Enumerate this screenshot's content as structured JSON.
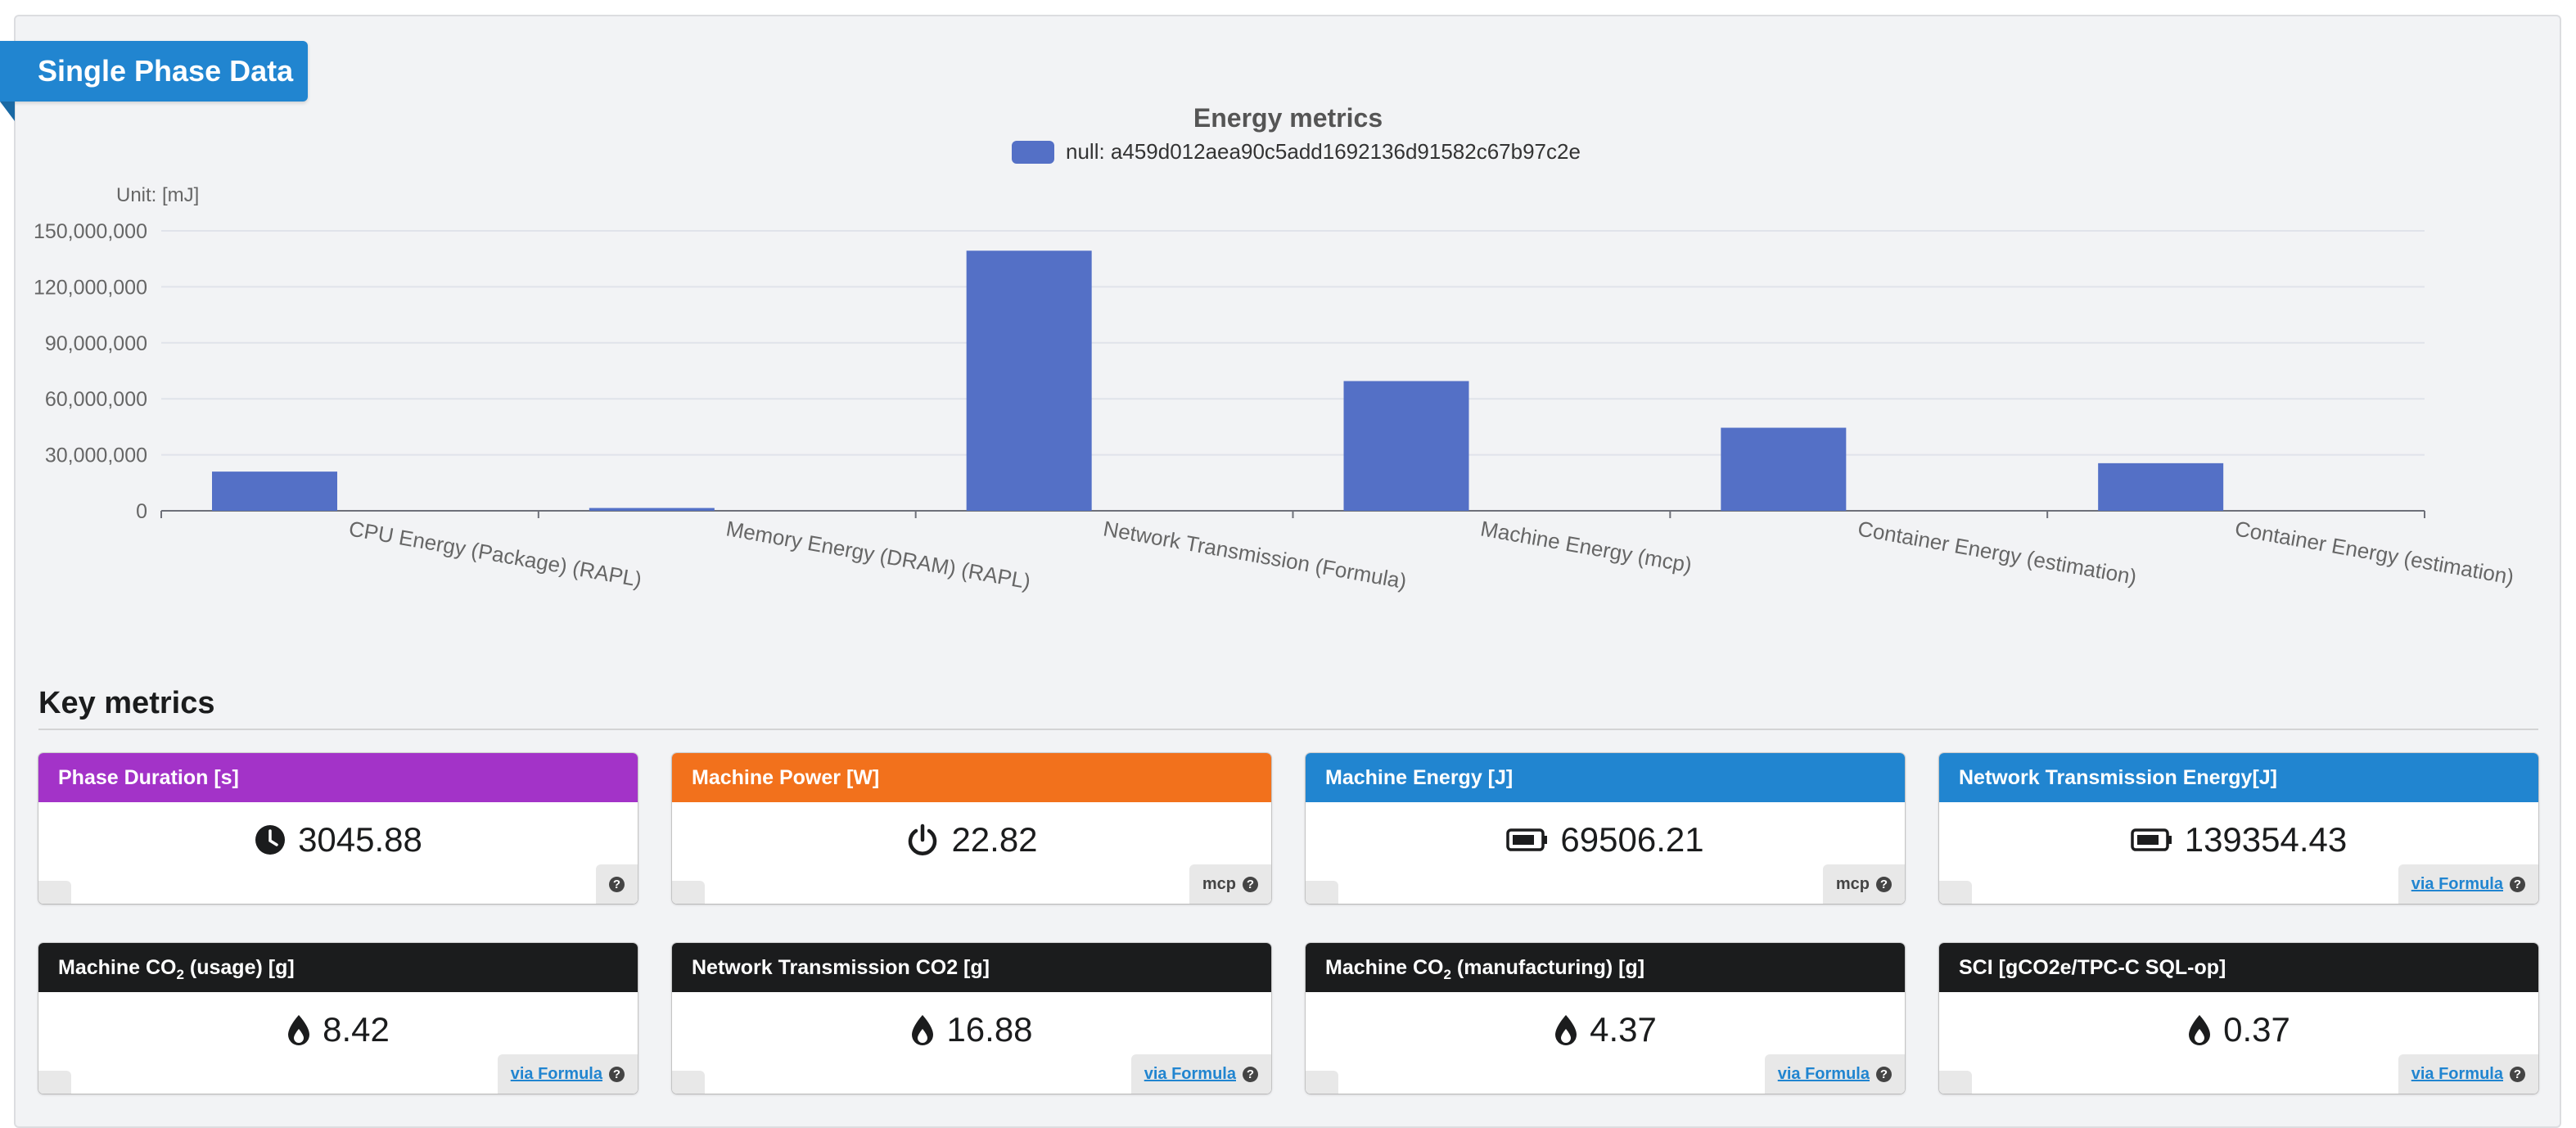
{
  "ribbon": {
    "title": "Single Phase Data"
  },
  "chart_data": {
    "type": "bar",
    "title": "Energy metrics",
    "legend": "null: a459d012aea90c5add1692136d91582c67b97c2e",
    "unit_label": "Unit: [mJ]",
    "categories": [
      "CPU Energy (Package) (RAPL)",
      "Memory Energy (DRAM) (RAPL)",
      "Network Transmission (Formula)",
      "Machine Energy (mcp)",
      "Container Energy (estimation)",
      "Container Energy (estimation)"
    ],
    "values": [
      21000000,
      1500000,
      139354430,
      69506210,
      44500000,
      25500000
    ],
    "ylim": [
      0,
      150000000
    ],
    "yticks": [
      0,
      30000000,
      60000000,
      90000000,
      120000000,
      150000000
    ],
    "ytick_labels": [
      "0",
      "30,000,000",
      "60,000,000",
      "90,000,000",
      "120,000,000",
      "150,000,000"
    ],
    "bar_color": "#5470c6",
    "grid": true,
    "legend_position": "top-center"
  },
  "key_metrics": {
    "title": "Key metrics",
    "cards": [
      {
        "title": "Phase Duration [s]",
        "value": "3045.88",
        "icon": "clock-icon",
        "color": "#a333c8",
        "source": "",
        "link": ""
      },
      {
        "title": "Machine Power [W]",
        "value": "22.82",
        "icon": "power-icon",
        "color": "#f2711c",
        "source": "mcp",
        "link": ""
      },
      {
        "title": "Machine Energy [J]",
        "value": "69506.21",
        "icon": "battery-icon",
        "color": "#2185d0",
        "source": "mcp",
        "link": ""
      },
      {
        "title": "Network Transmission Energy[J]",
        "value": "139354.43",
        "icon": "battery-icon",
        "color": "#2185d0",
        "source": "",
        "link": "via Formula"
      },
      {
        "title_pre": "Machine CO",
        "title_sub": "2",
        "title_post": " (usage) [g]",
        "value": "8.42",
        "icon": "flame-icon",
        "color": "#1b1c1d",
        "source": "",
        "link": "via Formula"
      },
      {
        "title": "Network Transmission CO2 [g]",
        "value": "16.88",
        "icon": "flame-icon",
        "color": "#1b1c1d",
        "source": "",
        "link": "via Formula"
      },
      {
        "title_pre": "Machine CO",
        "title_sub": "2",
        "title_post": " (manufacturing) [g]",
        "value": "4.37",
        "icon": "flame-icon",
        "color": "#1b1c1d",
        "source": "",
        "link": "via Formula"
      },
      {
        "title": "SCI [gCO2e/TPC-C SQL-op]",
        "value": "0.37",
        "icon": "flame-icon",
        "color": "#1b1c1d",
        "source": "",
        "link": "via Formula"
      }
    ]
  }
}
